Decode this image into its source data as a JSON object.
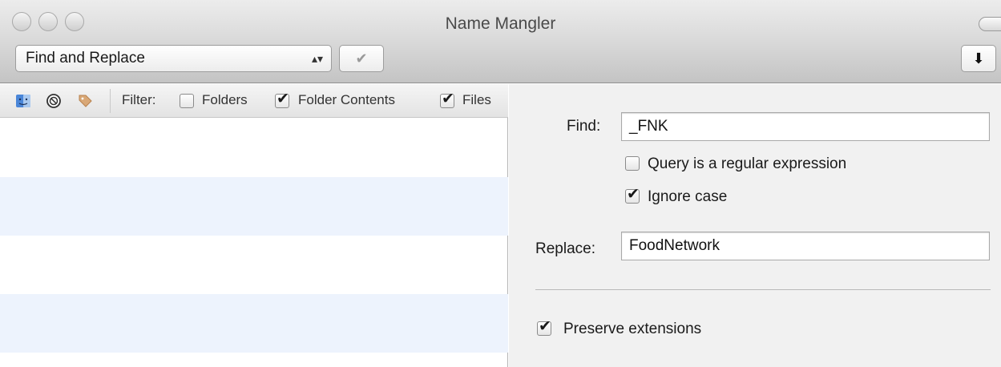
{
  "window": {
    "title": "Name Mangler"
  },
  "toolbar": {
    "mode_select": "Find and Replace",
    "select_arrows": "▴▾",
    "apply_glyph": "✔",
    "download_glyph": "⬇"
  },
  "filter_bar": {
    "icons": [
      "finder-icon",
      "no-entry-icon",
      "tag-icon"
    ],
    "filter_label": "Filter:",
    "options": [
      {
        "label": "Folders",
        "checked": false
      },
      {
        "label": "Folder Contents",
        "checked": true
      },
      {
        "label": "Files",
        "checked": true
      }
    ]
  },
  "form": {
    "find_label": "Find:",
    "find_value": "_FNK",
    "regex_label": "Query is a regular expression",
    "regex_checked": false,
    "ignore_case_label": "Ignore case",
    "ignore_case_checked": true,
    "replace_label": "Replace:",
    "replace_value": "FoodNetwork",
    "preserve_label": "Preserve extensions",
    "preserve_checked": true
  }
}
